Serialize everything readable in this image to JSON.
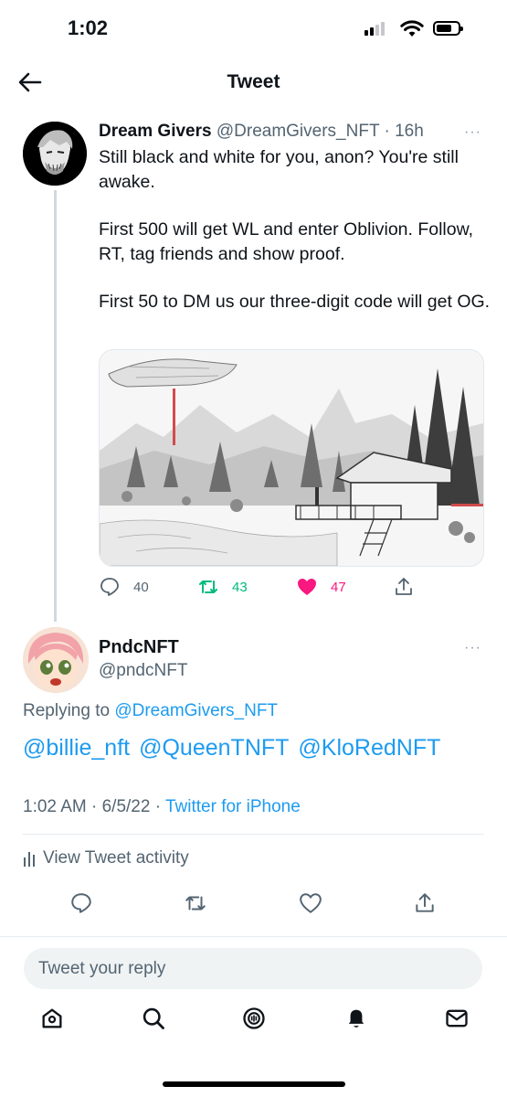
{
  "status_bar": {
    "time": "1:02"
  },
  "header": {
    "title": "Tweet"
  },
  "main_tweet": {
    "author_name": "Dream Givers",
    "meta": "@DreamGivers_NFT · 16h",
    "more": "···",
    "paragraphs": [
      "Still black and white for you, anon? You're still awake.",
      "First 500 will get WL and enter Oblivion. Follow, RT, tag friends and show proof.",
      "First 50 to DM us our three-digit code will get OG."
    ],
    "replies": "40",
    "retweets": "43",
    "likes": "47",
    "colors": {
      "retweet": "#00ba7c",
      "like": "#f91880"
    }
  },
  "reply_tweet": {
    "author_name": "PndcNFT",
    "handle": "@pndcNFT",
    "more": "···",
    "replying_prefix": "Replying to",
    "replying_to": "@DreamGivers_NFT",
    "mentions": [
      "@billie_nft",
      "@QueenTNFT",
      "@KloRedNFT"
    ],
    "timestamp": "1:02 AM · 6/5/22 · ",
    "source": "Twitter for iPhone",
    "activity_label": "View Tweet activity"
  },
  "composer": {
    "placeholder": "Tweet your reply"
  },
  "accent": "#1d9bf0"
}
